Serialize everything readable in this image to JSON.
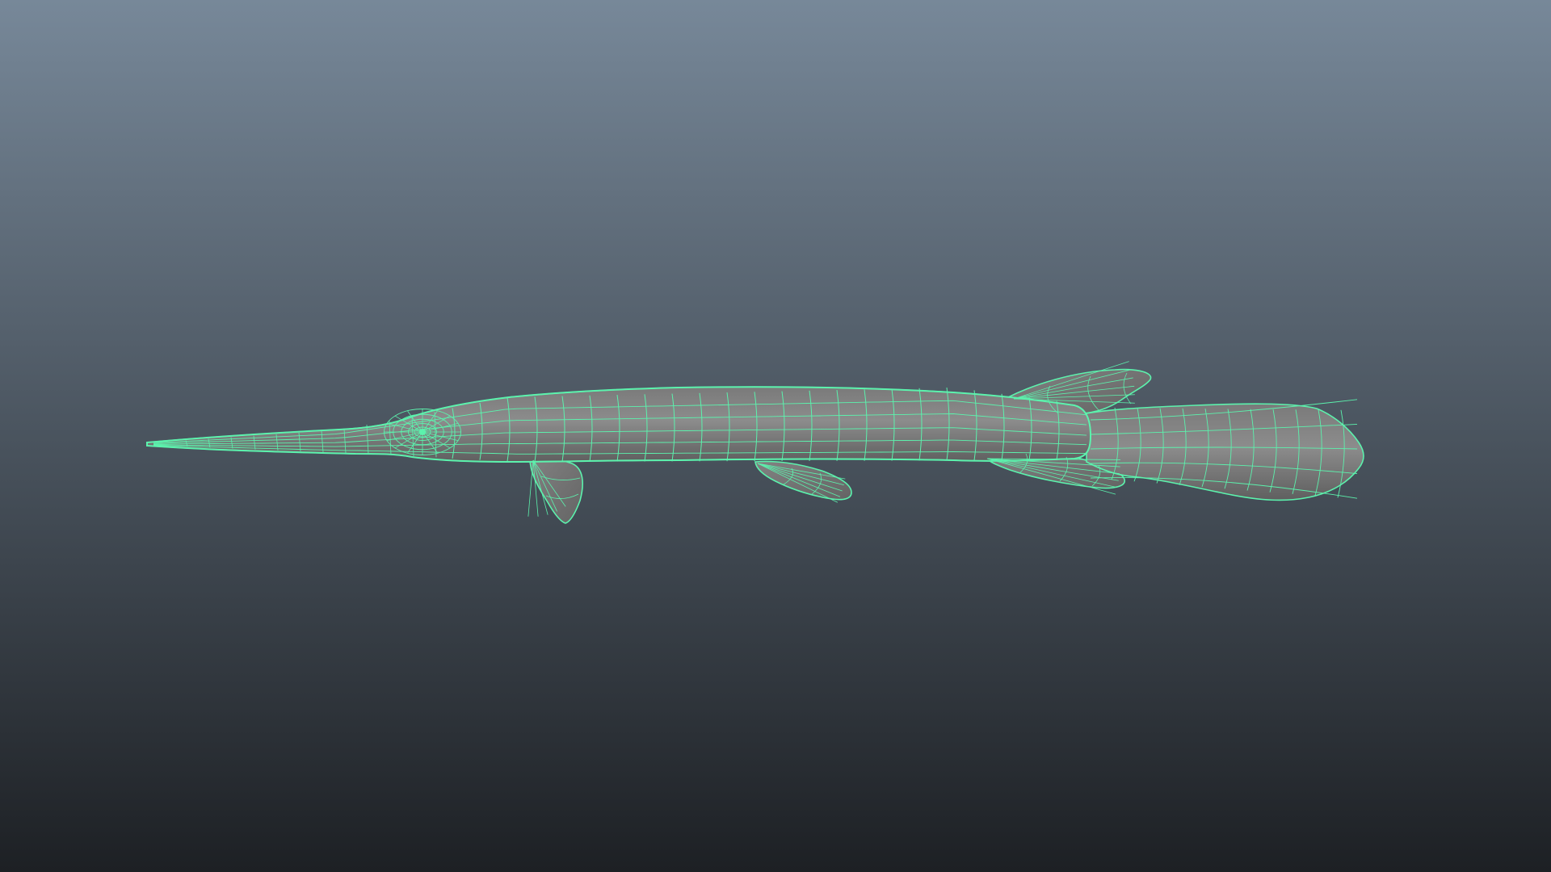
{
  "viewport": {
    "background_top": "#778899",
    "background_bottom": "#1d2024",
    "model_name": "",
    "display_mode": "wireframe-on-shaded",
    "selected": true
  },
  "colors": {
    "wireframe": "#5cf2ad",
    "surface": "#7b7b7b",
    "surface_highlight": "#8f8f8f",
    "surface_shadow": "#5e5e5e"
  },
  "model": {
    "object": "gar-fish-icon",
    "parts": [
      "snout",
      "head",
      "eye",
      "body",
      "dorsal-fin",
      "pectoral-fin",
      "pelvic-fin",
      "anal-fin",
      "caudal-fin"
    ]
  }
}
